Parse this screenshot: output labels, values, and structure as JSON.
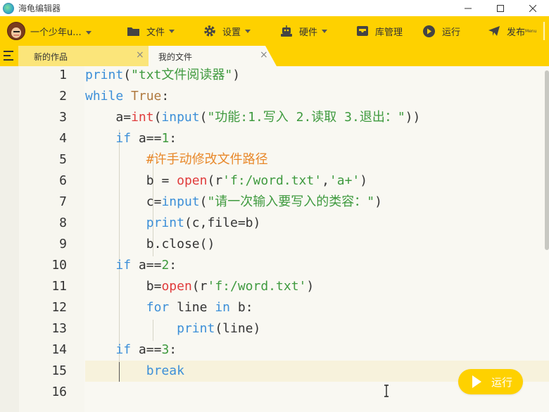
{
  "window": {
    "title": "海龟编辑器"
  },
  "toolbar": {
    "user_name": "一个少年u...",
    "menus": {
      "file": "文件",
      "settings": "设置",
      "hardware": "硬件",
      "library": "库管理",
      "run": "运行",
      "publish": "发布",
      "publish_sup": "Menu"
    }
  },
  "tabs": [
    {
      "label": "新的作品",
      "active": false
    },
    {
      "label": "我的文件",
      "active": true
    }
  ],
  "editor": {
    "current_line": 15,
    "lines": [
      {
        "n": "1",
        "text": "print(\"txt文件阅读器\")"
      },
      {
        "n": "2",
        "text": "while True:"
      },
      {
        "n": "3",
        "text": "    a=int(input(\"功能:1.写入 2.读取 3.退出：\"))"
      },
      {
        "n": "4",
        "text": "    if a==1:"
      },
      {
        "n": "5",
        "text": "        #许手动修改文件路径"
      },
      {
        "n": "6",
        "text": "        b = open(r'f:/word.txt','a+')"
      },
      {
        "n": "7",
        "text": "        c=input(\"请一次输入要写入的类容：\")"
      },
      {
        "n": "8",
        "text": "        print(c,file=b)"
      },
      {
        "n": "9",
        "text": "        b.close()"
      },
      {
        "n": "10",
        "text": "    if a==2:"
      },
      {
        "n": "11",
        "text": "        b=open(r'f:/word.txt')"
      },
      {
        "n": "12",
        "text": "        for line in b:"
      },
      {
        "n": "13",
        "text": "            print(line)"
      },
      {
        "n": "14",
        "text": "    if a==3:"
      },
      {
        "n": "15",
        "text": "        break"
      },
      {
        "n": "16",
        "text": ""
      }
    ]
  },
  "run_button": {
    "label": "运行"
  },
  "colors": {
    "accent": "#fed100",
    "keyword": "#3c8fd8",
    "string": "#3f9a3f",
    "comment": "#e8882a",
    "builtin": "#e03c3c"
  }
}
